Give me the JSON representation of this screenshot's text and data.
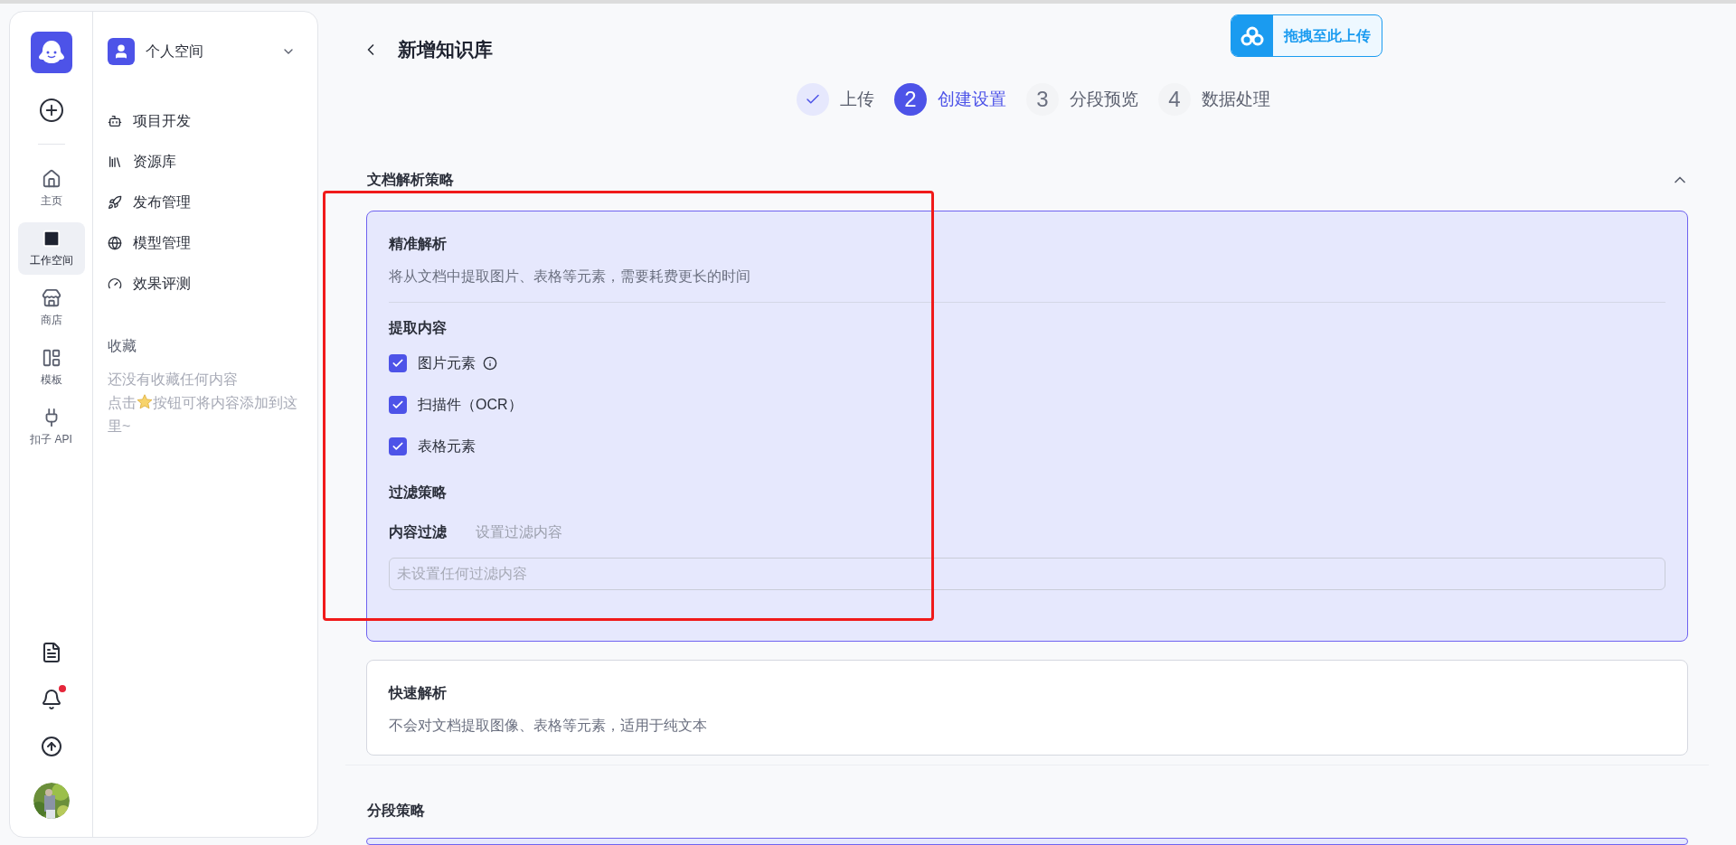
{
  "rail": {
    "items": [
      {
        "label": "主页",
        "selected": false
      },
      {
        "label": "工作空间",
        "selected": true
      },
      {
        "label": "商店",
        "selected": false
      },
      {
        "label": "模板",
        "selected": false
      },
      {
        "label": "扣子 API",
        "selected": false
      }
    ],
    "bottom": [
      {
        "badge": false
      },
      {
        "badge": true
      },
      {
        "badge": false
      }
    ]
  },
  "sidebar": {
    "space": "个人空间",
    "items": [
      {
        "label": "项目开发"
      },
      {
        "label": "资源库"
      },
      {
        "label": "发布管理"
      },
      {
        "label": "模型管理"
      },
      {
        "label": "效果评测"
      }
    ],
    "favorites": {
      "title": "收藏",
      "empty": "还没有收藏任何内容",
      "hint_before": "点击",
      "hint_after": "按钮可将内容添加到这里~"
    }
  },
  "header": {
    "title": "新增知识库"
  },
  "steps": [
    {
      "kind": "done",
      "label": "上传"
    },
    {
      "kind": "current",
      "number": "2",
      "label": "创建设置"
    },
    {
      "kind": "todo",
      "number": "3",
      "label": "分段预览"
    },
    {
      "kind": "todo",
      "number": "4",
      "label": "数据处理"
    }
  ],
  "upload_badge": {
    "label": "拖拽至此上传"
  },
  "parse_section": {
    "title": "文档解析策略",
    "expanded": true,
    "options": [
      {
        "kind": "precise",
        "title": "精准解析",
        "description": "将从文档中提取图片、表格等元素，需要耗费更长的时间",
        "selected": true,
        "extract_title": "提取内容",
        "extract": [
          {
            "label": "图片元素",
            "checked": true,
            "info": true
          },
          {
            "label": "扫描件（OCR）",
            "checked": true,
            "info": false
          },
          {
            "label": "表格元素",
            "checked": true,
            "info": false
          }
        ],
        "filter_title": "过滤策略",
        "filter_label": "内容过滤",
        "filter_link": "设置过滤内容",
        "filter_placeholder": "未设置任何过滤内容"
      },
      {
        "kind": "fast",
        "title": "快速解析",
        "description": "不会对文档提取图像、表格等元素，适用于纯文本",
        "selected": false
      }
    ]
  },
  "segment_section": {
    "title": "分段策略"
  }
}
